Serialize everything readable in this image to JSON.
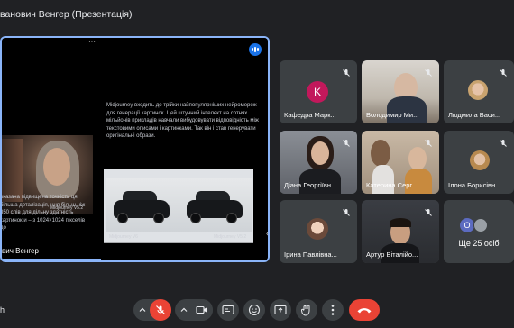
{
  "meeting": {
    "presenter_title": "ванович Венгер (Презентація)",
    "presenter_caption": "вич Венгер",
    "left_edge_text": "h"
  },
  "slide": {
    "paragraph_right": "Midjourney входить до трійки найпопулярніших нейромереж для генерації картинок. Цей штучний інтелект на сотнях мільйонів прикладів навчали вибудовувати відповідність між текстовими описами і картинками. Так він і став генерувати оригінальні образи.",
    "paragraph_left": "вказана підвищена точність ця більша деталізація, ння більш ніж 350 слів для дільну здатність картинок и – з 1024×1024 пікселів до",
    "caption_portrait": "Midjourney V5.2",
    "caption_car1": "Midjourney V6",
    "caption_car2": "Midjourney V5.2"
  },
  "participants": [
    {
      "name": "Кафедра Марк...",
      "type": "initial",
      "initial": "K",
      "muted": true
    },
    {
      "name": "Володимир Ми...",
      "type": "video",
      "muted": true
    },
    {
      "name": "Людмила Васи...",
      "type": "photo",
      "muted": true
    },
    {
      "name": "Діана Георгіївн...",
      "type": "video",
      "muted": true
    },
    {
      "name": "Катерина Серг...",
      "type": "video",
      "muted": true
    },
    {
      "name": "Ілона Борисівн...",
      "type": "photo",
      "muted": true
    },
    {
      "name": "Ірина Павлівна...",
      "type": "photo",
      "muted": true
    },
    {
      "name": "Артур Віталійо...",
      "type": "video",
      "muted": true
    }
  ],
  "more": {
    "label": "Ще 25 осіб",
    "initial": "O"
  },
  "colors": {
    "background": "#202124",
    "tile": "#3c4043",
    "accent": "#8ab4f8",
    "danger": "#ea4335",
    "k_avatar": "#c2185b"
  },
  "controls": [
    {
      "icon": "chevron-up-icon"
    },
    {
      "icon": "mic-off-icon"
    },
    {
      "icon": "camera-icon"
    },
    {
      "icon": "captions-icon"
    },
    {
      "icon": "emoji-icon"
    },
    {
      "icon": "present-icon"
    },
    {
      "icon": "raise-hand-icon"
    },
    {
      "icon": "more-vert-icon"
    },
    {
      "icon": "end-call-icon"
    }
  ]
}
